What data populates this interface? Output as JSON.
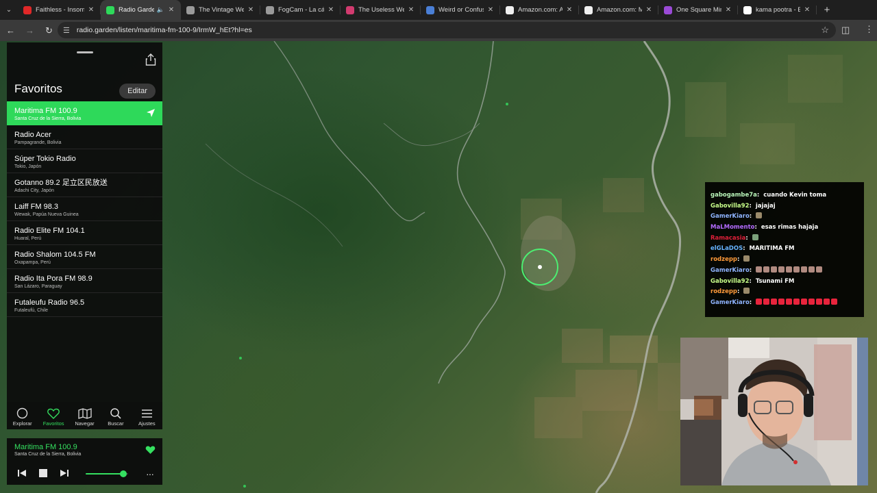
{
  "browser": {
    "tabs": [
      {
        "title": "Faithless - Insomn",
        "favicon_color": "#e02828",
        "active": false
      },
      {
        "title": "Radio Garden",
        "favicon_color": "#2ed95a",
        "active": true,
        "audio": "🔈"
      },
      {
        "title": "The Vintage Web",
        "favicon_color": "#9a9a9a",
        "active": false
      },
      {
        "title": "FogCam - La cáma",
        "favicon_color": "#9a9a9a",
        "active": false
      },
      {
        "title": "The Useless Web",
        "favicon_color": "#d23b6f",
        "active": false
      },
      {
        "title": "Weird or Confusin",
        "favicon_color": "#4a7fd6",
        "active": false
      },
      {
        "title": "Amazon.com: Am",
        "favicon_color": "#f0f0f0",
        "active": false
      },
      {
        "title": "Amazon.com: Me",
        "favicon_color": "#f0f0f0",
        "active": false
      },
      {
        "title": "One Square Mine",
        "favicon_color": "#9a4ad6",
        "active": false
      },
      {
        "title": "kama pootra - Bus",
        "favicon_color": "#ffffff",
        "active": false
      }
    ],
    "new_tab_label": "+",
    "url": "radio.garden/listen/maritima-fm-100-9/IrmW_hEt?hl=es"
  },
  "sidebar": {
    "title": "Favoritos",
    "edit_label": "Editar",
    "stations": [
      {
        "name": "Maritima FM 100.9",
        "location": "Santa Cruz de la Sierra, Bolivia",
        "active": true
      },
      {
        "name": "Radio Acer",
        "location": "Pampagrande, Bolivia"
      },
      {
        "name": "Súper Tokio Radio",
        "location": "Tokio, Japón"
      },
      {
        "name": "Gotanno 89.2 足立区民放送",
        "location": "Adachi City, Japón"
      },
      {
        "name": "Laiff FM 98.3",
        "location": "Wewak, Papúa Nueva Guinea"
      },
      {
        "name": "Radio Elite FM 104.1",
        "location": "Huaral, Perú"
      },
      {
        "name": "Radio Shalom 104.5 FM",
        "location": "Oxapampa, Perú"
      },
      {
        "name": "Radio Ita Pora FM 98.9",
        "location": "San Lázaro, Paraguay"
      },
      {
        "name": "Futaleufu Radio 96.5",
        "location": "Futaleufú, Chile"
      }
    ]
  },
  "bottom_nav": [
    {
      "label": "Explorar",
      "icon": "circle-icon"
    },
    {
      "label": "Favoritos",
      "icon": "heart-icon",
      "active": true
    },
    {
      "label": "Navegar",
      "icon": "map-icon"
    },
    {
      "label": "Buscar",
      "icon": "search-icon"
    },
    {
      "label": "Ajustes",
      "icon": "menu-icon"
    }
  ],
  "player": {
    "station": "Maritima FM 100.9",
    "location": "Santa Cruz de la Sierra, Bolivia",
    "volume": 0.88
  },
  "chat": {
    "messages": [
      {
        "user": "gabogambe7a",
        "color": "#b9f5b9",
        "text": "cuando Kevin toma"
      },
      {
        "user": "Gabovilla92",
        "color": "#c8ff8a",
        "text": "jajajaj"
      },
      {
        "user": "GamerKiaro",
        "color": "#8fb4ff",
        "text": "",
        "emotes": 1,
        "emote_color": "#9a8a6a"
      },
      {
        "user": "MaLMomento",
        "color": "#b36bff",
        "text": "esas rimas hajaja"
      },
      {
        "user": "Ramacasia",
        "color": "#e0203a",
        "text": "",
        "emotes": 1,
        "emote_color": "#7aa07a"
      },
      {
        "user": "elGLaDOS",
        "color": "#66b3ff",
        "text": "MARITIMA FM"
      },
      {
        "user": "rodzepp",
        "color": "#ff9a3a",
        "text": "",
        "emotes": 1,
        "emote_color": "#9a8a6a"
      },
      {
        "user": "GamerKiaro",
        "color": "#8fb4ff",
        "text": "",
        "emotes": 9,
        "emote_color": "#b08a80"
      },
      {
        "user": "Gabovilla92",
        "color": "#c8ff8a",
        "text": "Tsunami FM"
      },
      {
        "user": "rodzepp",
        "color": "#ff9a3a",
        "text": "",
        "emotes": 1,
        "emote_color": "#9a8a6a"
      },
      {
        "user": "GamerKiaro",
        "color": "#8fb4ff",
        "text": "",
        "emotes": 11,
        "emote_color": "#e8243c"
      }
    ]
  },
  "colors": {
    "accent": "#2ed95a",
    "panel": "#0c0c0c"
  }
}
